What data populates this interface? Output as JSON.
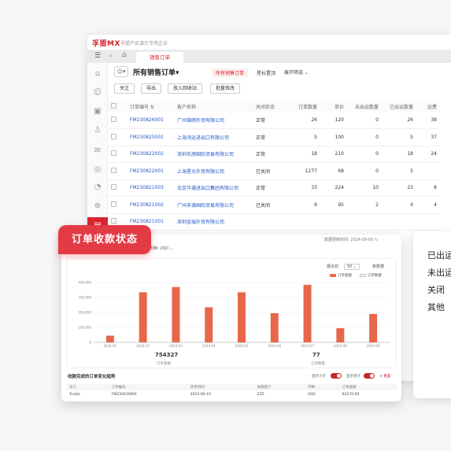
{
  "brand": {
    "logo": "孚盟MX",
    "subtitle": "孚盟产品演示专用企业"
  },
  "tabs": {
    "active": "销售订单"
  },
  "view": {
    "title": "所有销售订单",
    "chip_active": "所有销售订单",
    "chip_other": "星标置顶",
    "filter": "展开筛选"
  },
  "toolbar": {
    "follow": "关注",
    "export": "导出",
    "recycle": "放入回收站",
    "batch_edit": "批量修改"
  },
  "table": {
    "headers": [
      "订单编号",
      "客户名称",
      "关闭状态",
      "订单数量",
      "单价",
      "未出运数量",
      "已出运数量",
      "运费"
    ],
    "rows": [
      [
        "FM230826001",
        "广州锦绣外贸有限公司",
        "正常",
        "26",
        "120",
        "0",
        "26",
        "38"
      ],
      [
        "FM230825001",
        "上海鸿运进出口有限公司",
        "正常",
        "5",
        "100",
        "0",
        "5",
        "37"
      ],
      [
        "FM230822002",
        "深圳东旭国际贸易有限公司",
        "正常",
        "18",
        "210",
        "0",
        "18",
        "24"
      ],
      [
        "FM230822001",
        "上海星光外贸有限公司",
        "已关闭",
        "1277",
        "68",
        "0",
        "5",
        ""
      ],
      [
        "FM230821003",
        "北京华通进出口集团有限公司",
        "正常",
        "33",
        "224",
        "10",
        "23",
        "8"
      ],
      [
        "FM230821002",
        "广州丰源国际贸易有限公司",
        "已关闭",
        "6",
        "95",
        "2",
        "4",
        "4"
      ],
      [
        "FM230821001",
        "深圳金瑞外贸有限公司",
        "",
        "",
        "",
        "",
        "",
        ""
      ]
    ]
  },
  "badge": {
    "label": "订单收款状态"
  },
  "card": {
    "currency": "币种: USD",
    "updated": "数据更新时间: 2024-09-05",
    "chart_ctrl_1": "展示前",
    "chart_ctrl_2": "50",
    "chart_ctrl_3": "条数据",
    "legend_1": "订单金额",
    "legend_2": "订单数量",
    "stat_1_value": "754327",
    "stat_1_label": "订单金额",
    "stat_2_value": "77",
    "stat_2_label": "订单数量",
    "sub_title": "收款完成的订单变化趋势",
    "toggle_1": "显示小计",
    "toggle_2": "显示合计",
    "reset": "重置",
    "mini_headers": [
      "员工",
      "订单编号",
      "签单时间",
      "关联客户",
      "币种",
      "订单金额"
    ],
    "mini_row": [
      "Trudie",
      "FM230619001",
      "2023-06-19",
      "ZZZ",
      "USD",
      "83270.00"
    ]
  },
  "right_panel": {
    "items": [
      "已出运",
      "未出运",
      "关闭",
      "其他"
    ]
  },
  "colors": {
    "accent": "#d9232e",
    "bar": "#e8674a",
    "link": "#2457c5"
  },
  "chart_data": {
    "type": "bar",
    "categories": [
      "2024-01",
      "2024-02",
      "2024-03",
      "2024-04",
      "2024-05",
      "2024-06",
      "2024-07",
      "2024-08",
      "2024-09"
    ],
    "y_ticks": [
      "400,000",
      "300,000",
      "200,000",
      "100,000",
      "0"
    ],
    "series": [
      {
        "name": "订单金额",
        "values": [
          [
            45000,
            0
          ],
          [
            335000,
            0
          ],
          [
            370000,
            0
          ],
          [
            235000,
            0
          ],
          [
            335000,
            0
          ],
          [
            195000,
            0
          ],
          [
            385000,
            0
          ],
          [
            95000,
            0
          ],
          [
            190000,
            0
          ]
        ]
      }
    ],
    "ylim": [
      0,
      400000
    ]
  }
}
